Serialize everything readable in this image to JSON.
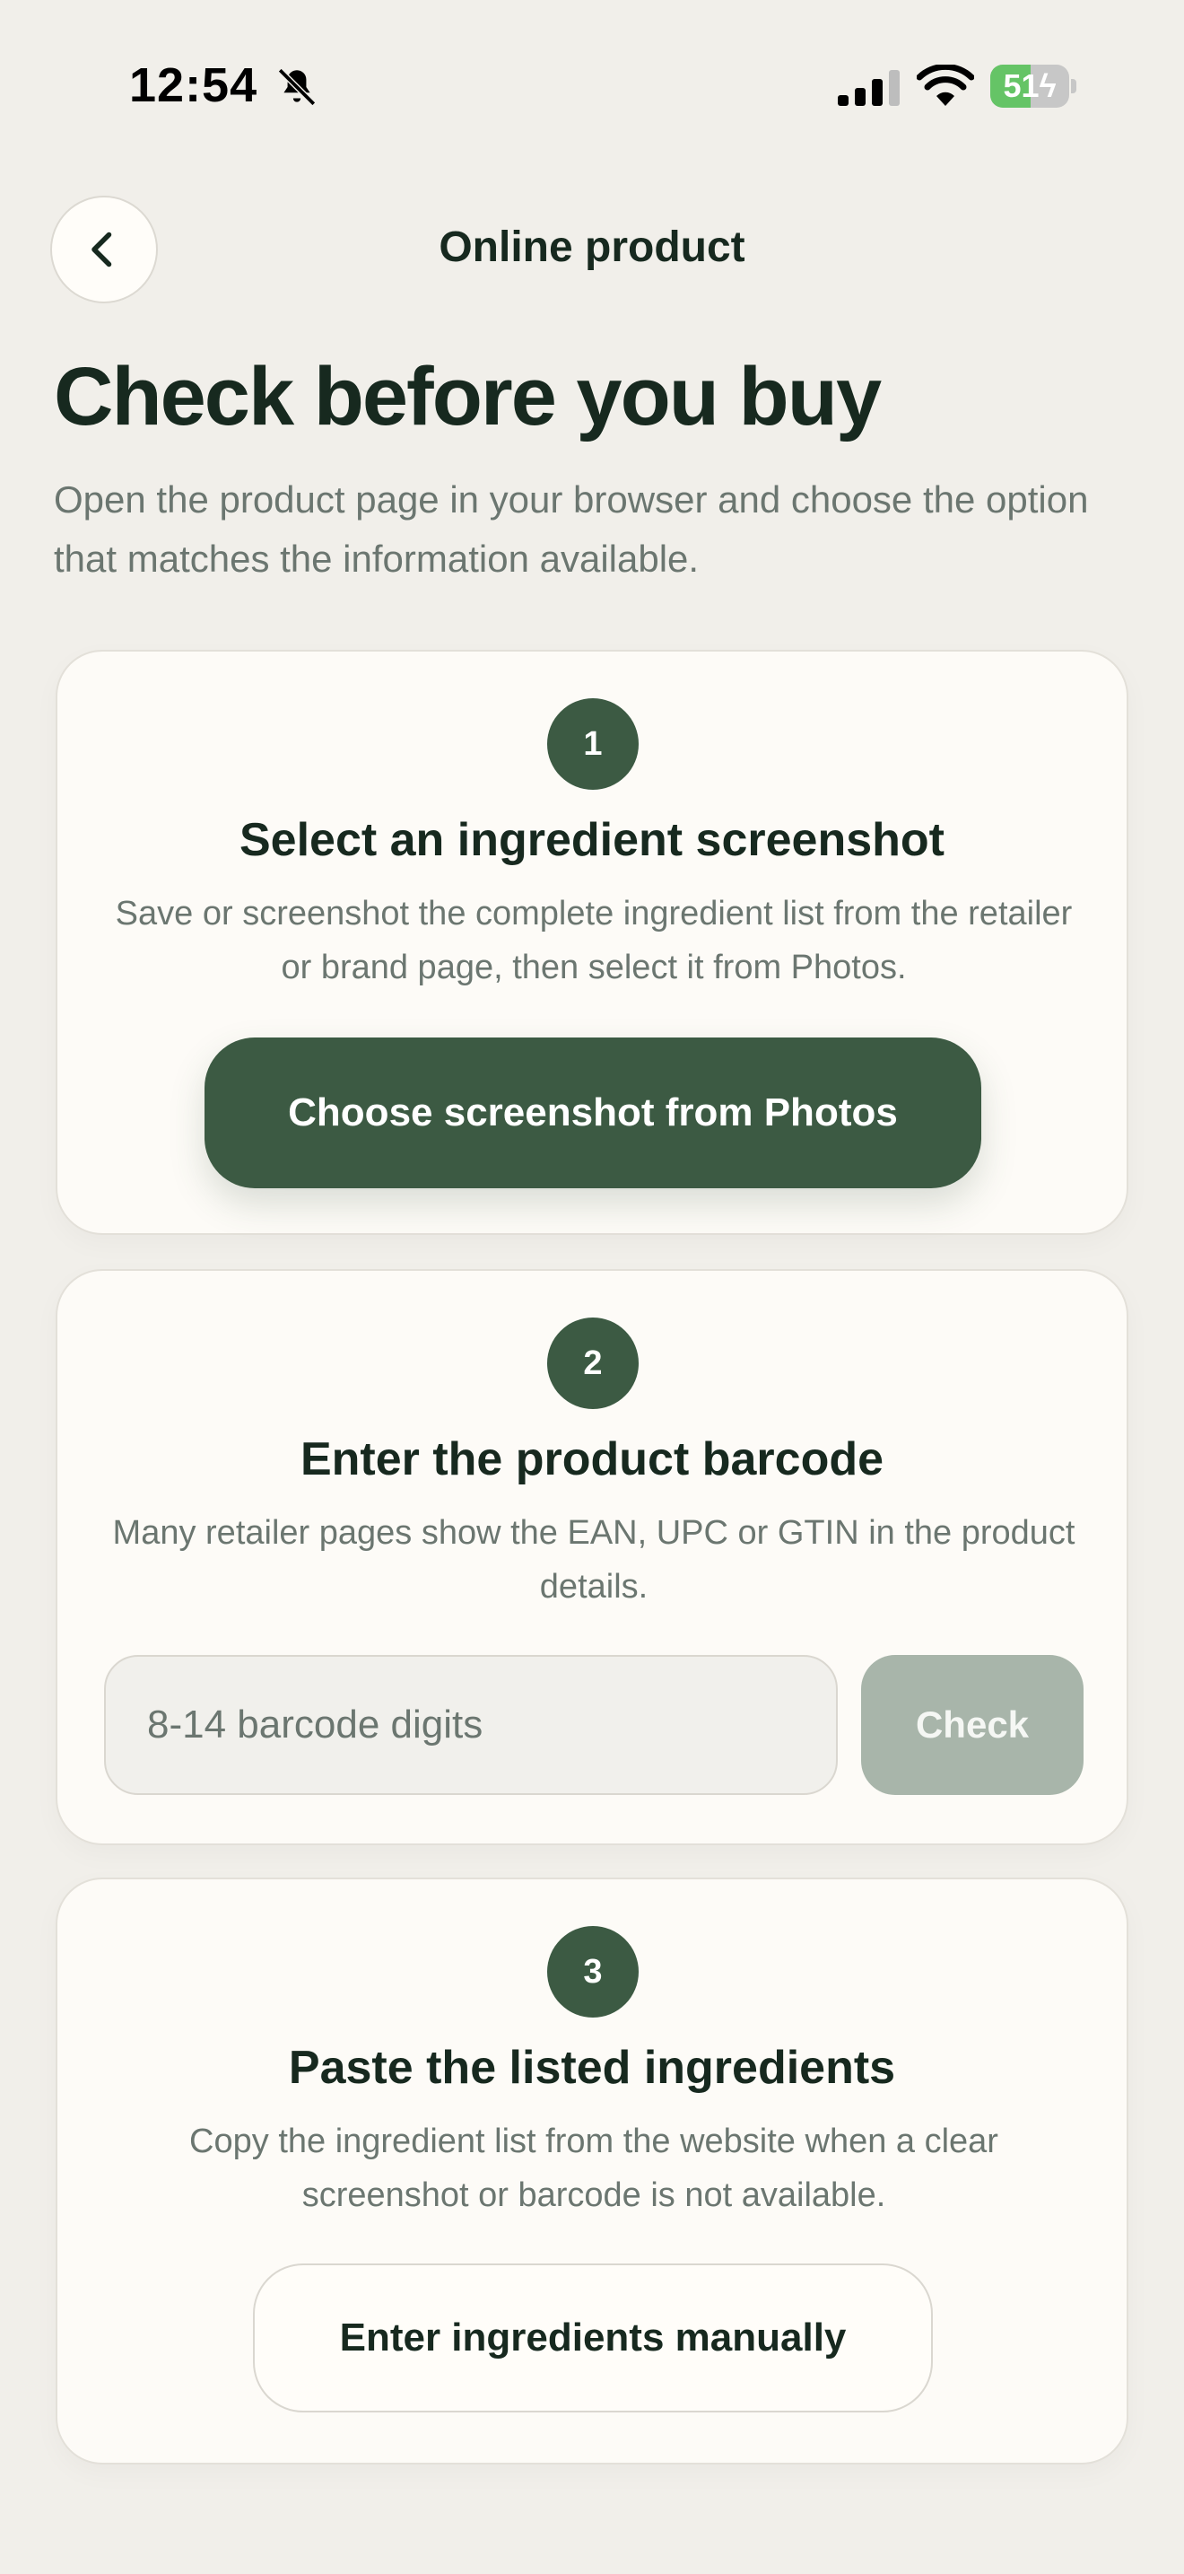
{
  "status_bar": {
    "time": "12:54",
    "battery_percent": 51,
    "battery_label": "51",
    "icons": [
      "bell-slash-icon",
      "cellular-signal-icon",
      "wifi-icon",
      "battery-charging-icon"
    ]
  },
  "header": {
    "back_icon": "chevron-left-icon",
    "title": "Online product"
  },
  "intro": {
    "title": "Check before you buy",
    "subtitle": "Open the product page in your browser and choose the option that matches the information available."
  },
  "options": [
    {
      "step": "1",
      "title": "Select an ingredient screenshot",
      "description": "Save or screenshot the complete ingredient list from the retailer or brand page, then select it from Photos.",
      "button_label": "Choose screenshot from Photos"
    },
    {
      "step": "2",
      "title": "Enter the product barcode",
      "description": "Many retailer pages show the EAN, UPC or GTIN in the product details.",
      "input_value": "",
      "input_placeholder": "8-14 barcode digits",
      "button_label": "Check"
    },
    {
      "step": "3",
      "title": "Paste the listed ingredients",
      "description": "Copy the ingredient list from the website when a clear screenshot or barcode is not available.",
      "button_label": "Enter ingredients manually"
    }
  ],
  "colors": {
    "background": "#F1EFEA",
    "card": "#FDFBF7",
    "accent": "#3C5A43",
    "accent_disabled": "#A8B5AA",
    "text_primary": "#17291F",
    "text_secondary": "#6B7670"
  }
}
